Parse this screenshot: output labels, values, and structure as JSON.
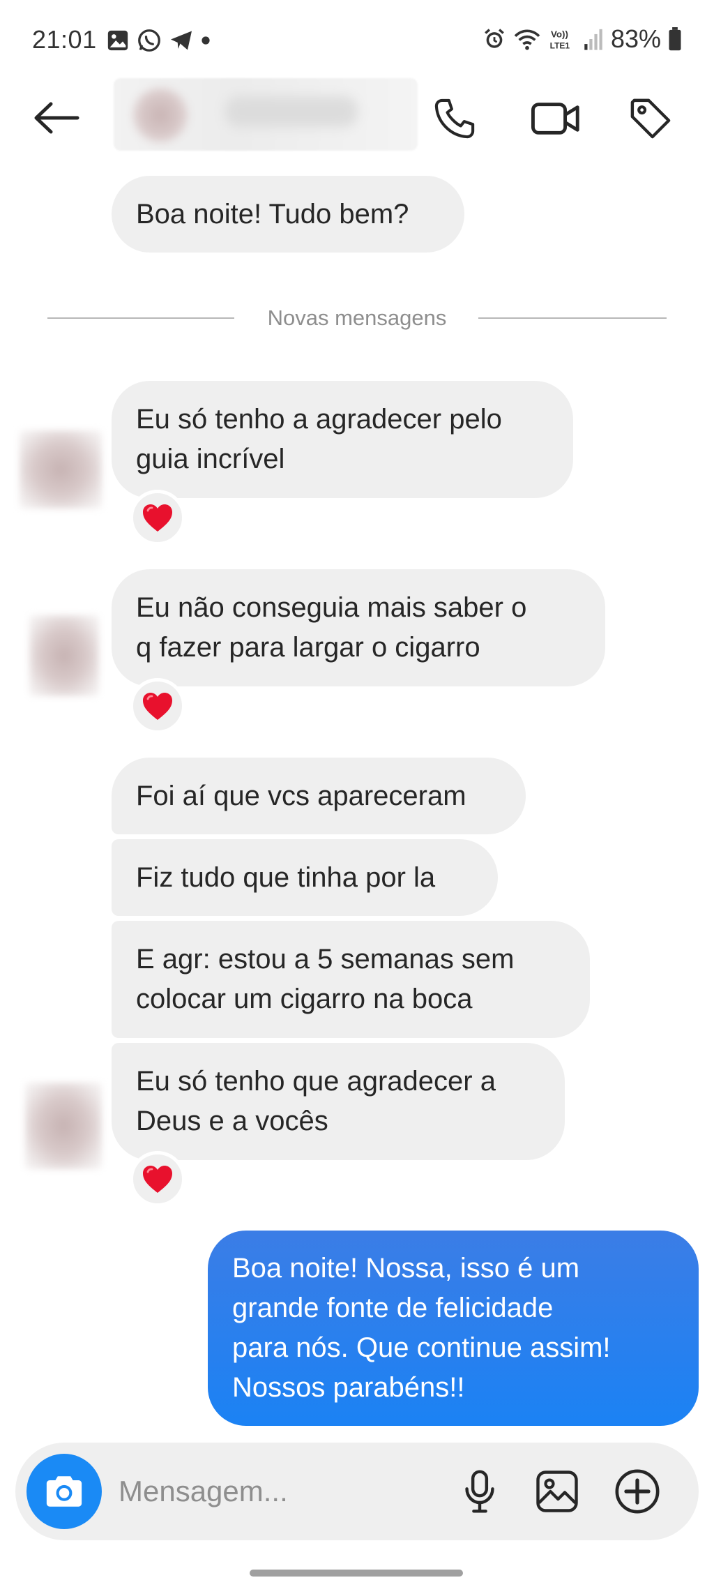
{
  "status_bar": {
    "time": "21:01",
    "battery": "83%",
    "network_label": "Vo)) LTE1"
  },
  "header": {
    "back_icon": "arrow-left-icon",
    "call_icon": "phone-icon",
    "video_icon": "video-camera-icon",
    "tag_icon": "tag-icon"
  },
  "divider": {
    "label": "Novas mensagens"
  },
  "messages": [
    {
      "text": "Boa noite! Tudo bem?"
    },
    {
      "text": "Eu só tenho a agradecer pelo\nguia incrível",
      "reaction": "❤️"
    },
    {
      "text": "Eu não conseguia mais saber o\nq fazer para largar o cigarro",
      "reaction": "❤️"
    },
    {
      "text": "Foi aí que vcs apareceram"
    },
    {
      "text": "Fiz tudo que tinha por la"
    },
    {
      "text": "E agr: estou a 5 semanas sem\ncolocar um cigarro na boca"
    },
    {
      "text": "Eu só tenho que agradecer a\nDeus e a vocês",
      "reaction": "❤️"
    },
    {
      "text": "Boa noite! Nossa, isso é um\ngrande fonte de felicidade\npara nós. Que continue assim!\nNossos parabéns!!"
    }
  ],
  "composer": {
    "placeholder": "Mensagem...",
    "camera_icon": "camera-icon",
    "mic_icon": "microphone-icon",
    "gallery_icon": "image-icon",
    "plus_icon": "plus-circle-icon"
  },
  "colors": {
    "incoming_bubble": "#efefef",
    "outgoing_bubble": "#1b82f4",
    "accent": "#1a8af5",
    "reaction_heart": "#e8112d"
  }
}
